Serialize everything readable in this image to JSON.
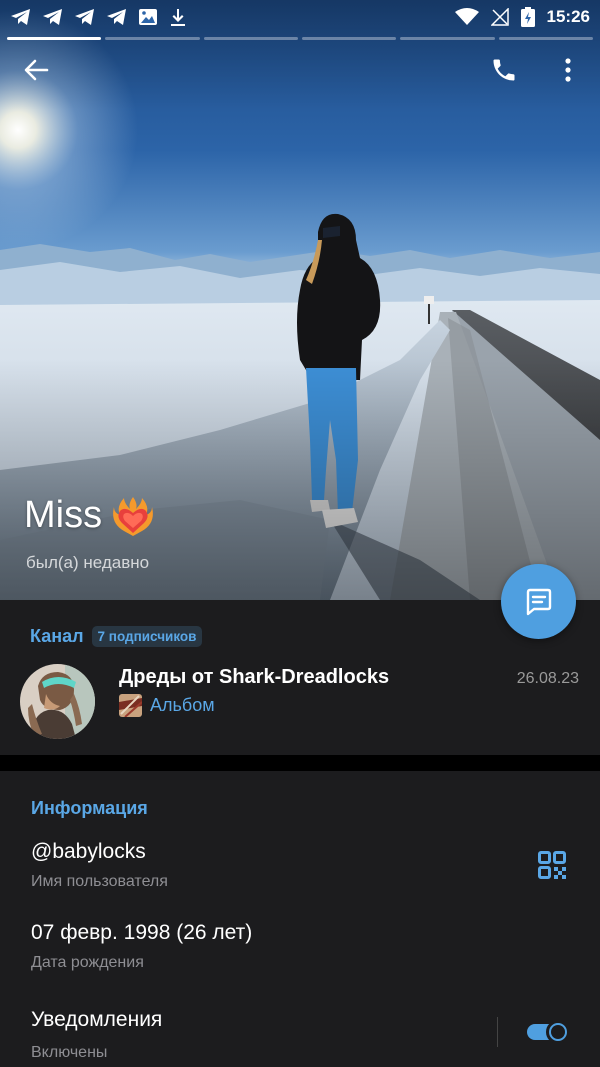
{
  "status_bar": {
    "time": "15:26",
    "icons": [
      "telegram-icon",
      "telegram-icon",
      "telegram-icon",
      "telegram-icon",
      "image-icon",
      "download-icon",
      "wifi-icon",
      "no-signal-icon",
      "battery-icon"
    ]
  },
  "story_segments": {
    "count": 6,
    "active_index": 0
  },
  "profile": {
    "name": "Miss",
    "name_emoji": "heart-on-fire-icon",
    "last_seen": "был(а) недавно"
  },
  "channel": {
    "section_label": "Канал",
    "subscribers": "7 подписчиков",
    "name": "Дреды от Shark-Dreadlocks",
    "date": "26.08.23",
    "last_post": "Альбом"
  },
  "info": {
    "section_label": "Информация",
    "username": "@babylocks",
    "username_label": "Имя пользователя",
    "birthday": "07 февр. 1998 (26 лет)",
    "birthday_label": "Дата рождения",
    "notifications": "Уведомления",
    "notifications_state": "Включены",
    "notifications_on": true
  },
  "colors": {
    "accent": "#5aa7e6",
    "fab": "#4f9fe0",
    "background": "#1c1c1e",
    "secondary_text": "#8e8e93"
  }
}
